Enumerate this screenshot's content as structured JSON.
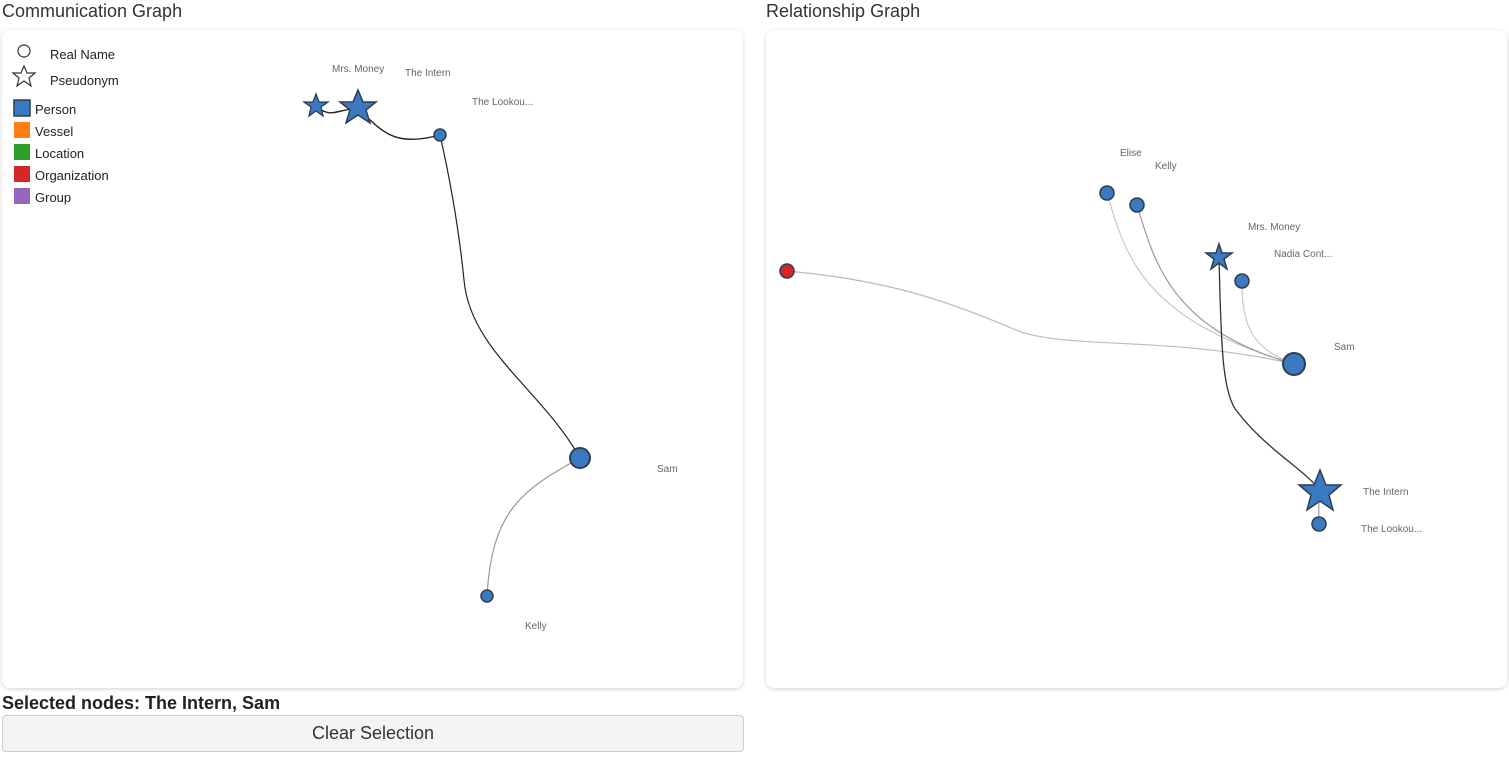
{
  "communication": {
    "title": "Communication Graph",
    "legend": {
      "shapes": [
        {
          "label": "Real Name",
          "icon": "circle-icon"
        },
        {
          "label": "Pseudonym",
          "icon": "star-icon"
        }
      ],
      "types": [
        {
          "label": "Person",
          "color": "#3a7ac0"
        },
        {
          "label": "Vessel",
          "color": "#ff7f0e"
        },
        {
          "label": "Location",
          "color": "#2ca02c"
        },
        {
          "label": "Organization",
          "color": "#d62728"
        },
        {
          "label": "Group",
          "color": "#9467bd"
        }
      ]
    },
    "node_labels": {
      "mrs_money": "Mrs. Money",
      "the_intern": "The Intern",
      "the_lookout": "The Lookou...",
      "sam": "Sam",
      "kelly": "Kelly"
    }
  },
  "relationship": {
    "title": "Relationship Graph",
    "node_labels": {
      "elise": "Elise",
      "kelly": "Kelly",
      "mrs_money": "Mrs. Money",
      "nadia": "Nadia Cont...",
      "sam": "Sam",
      "the_intern": "The Intern",
      "the_lookout": "The Lookou..."
    }
  },
  "selection": {
    "text": "Selected nodes: The Intern, Sam",
    "clear_label": "Clear Selection"
  },
  "colors": {
    "person": "#3a7ac0",
    "organization": "#d62728",
    "node_stroke": "#2f3d4f"
  }
}
